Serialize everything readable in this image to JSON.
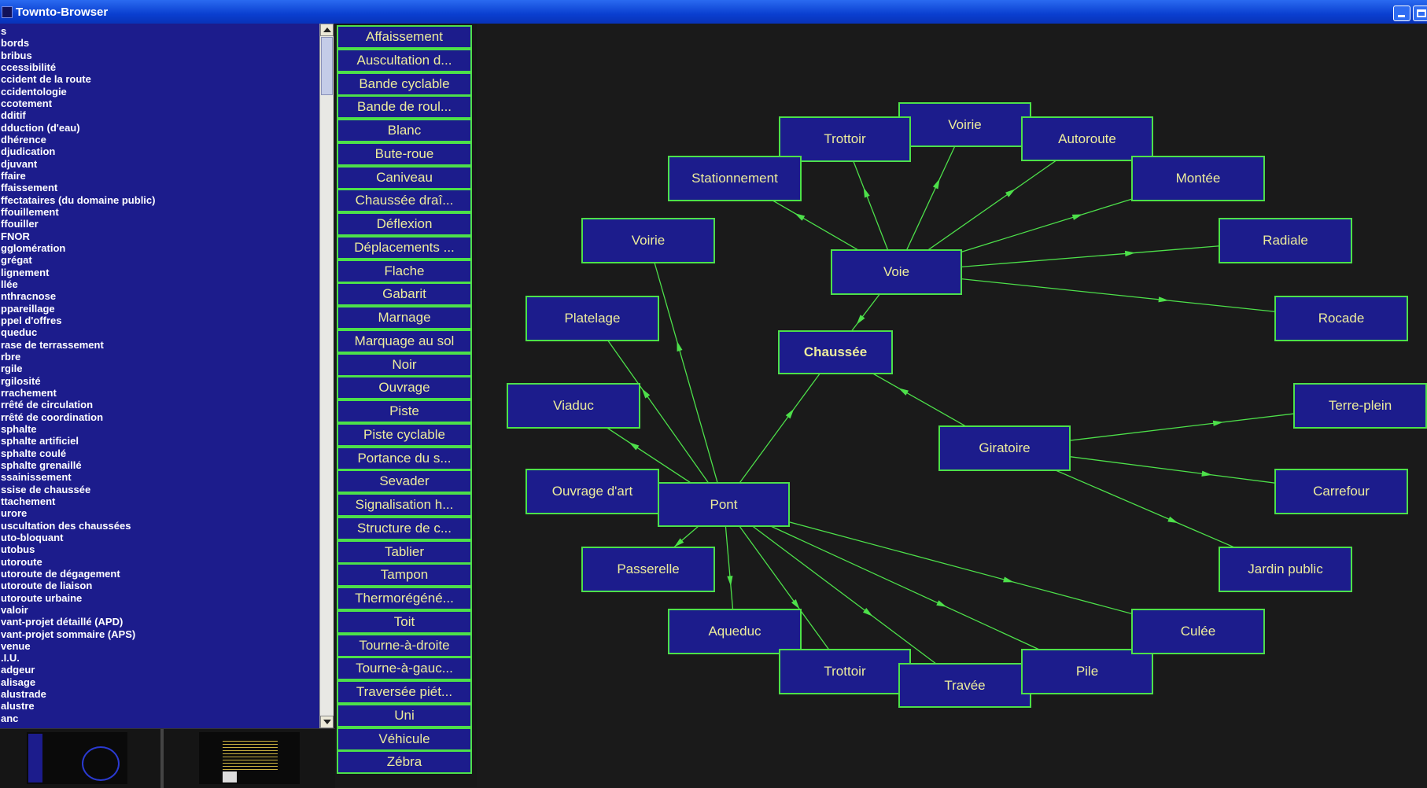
{
  "window": {
    "title": "Townto-Browser"
  },
  "word_list": [
    "s",
    "bords",
    "bribus",
    "ccessibilité",
    "ccident de la route",
    "ccidentologie",
    "ccotement",
    "dditif",
    "dduction (d'eau)",
    "dhérence",
    "djudication",
    "djuvant",
    "ffaire",
    "ffaissement",
    "ffectataires (du domaine public)",
    "ffouillement",
    "ffouiller",
    "FNOR",
    "gglomération",
    "grégat",
    "lignement",
    "llée",
    "nthracnose",
    "ppareillage",
    "ppel d'offres",
    "queduc",
    "rase de terrassement",
    "rbre",
    "rgile",
    "rgilosité",
    "rrachement",
    "rrêté de circulation",
    "rrêté de coordination",
    "sphalte",
    "sphalte artificiel",
    "sphalte coulé",
    "sphalte grenaillé",
    "ssainissement",
    "ssise de chaussée",
    "ttachement",
    "urore",
    "uscultation des chaussées",
    "uto-bloquant",
    "utobus",
    "utoroute",
    "utoroute de dégagement",
    "utoroute de liaison",
    "utoroute urbaine",
    "valoir",
    "vant-projet détaillé (APD)",
    "vant-projet sommaire (APS)",
    "venue",
    ".I.U.",
    "adgeur",
    "alisage",
    "alustrade",
    "alustre",
    "anc"
  ],
  "terms": [
    "Affaissement",
    "Auscultation d...",
    "Bande cyclable",
    "Bande de roul...",
    "Blanc",
    "Bute-roue",
    "Caniveau",
    "Chaussée draî...",
    "Déflexion",
    "Déplacements ...",
    "Flache",
    "Gabarit",
    "Marnage",
    "Marquage au sol",
    "Noir",
    "Ouvrage",
    "Piste",
    "Piste cyclable",
    "Portance du s...",
    "Sevader",
    "Signalisation h...",
    "Structure de c...",
    "Tablier",
    "Tampon",
    "Thermorégéné...",
    "Toit",
    "Tourne-à-droite",
    "Tourne-à-gauc...",
    "Traversée piét...",
    "Uni",
    "Véhicule",
    "Zébra"
  ],
  "graph": {
    "focus": "Chaussée",
    "nodes": [
      {
        "id": "chaussee",
        "label": "Chaussée",
        "focus": true
      },
      {
        "id": "voie",
        "label": "Voie"
      },
      {
        "id": "pont",
        "label": "Pont"
      },
      {
        "id": "giratoire",
        "label": "Giratoire"
      },
      {
        "id": "voirie-top",
        "label": "Voirie"
      },
      {
        "id": "trottoir-top",
        "label": "Trottoir"
      },
      {
        "id": "autoroute",
        "label": "Autoroute"
      },
      {
        "id": "stationnement",
        "label": "Stationnement"
      },
      {
        "id": "montee",
        "label": "Montée"
      },
      {
        "id": "radiale",
        "label": "Radiale"
      },
      {
        "id": "rocade",
        "label": "Rocade"
      },
      {
        "id": "voirie-left",
        "label": "Voirie"
      },
      {
        "id": "platelage",
        "label": "Platelage"
      },
      {
        "id": "viaduc",
        "label": "Viaduc"
      },
      {
        "id": "ouvrage-art",
        "label": "Ouvrage d'art"
      },
      {
        "id": "passerelle",
        "label": "Passerelle"
      },
      {
        "id": "aqueduc",
        "label": "Aqueduc"
      },
      {
        "id": "trottoir-bottom",
        "label": "Trottoir"
      },
      {
        "id": "travee",
        "label": "Travée"
      },
      {
        "id": "pile",
        "label": "Pile"
      },
      {
        "id": "culee",
        "label": "Culée"
      },
      {
        "id": "terre-plein",
        "label": "Terre-plein"
      },
      {
        "id": "carrefour",
        "label": "Carrefour"
      },
      {
        "id": "jardin-public",
        "label": "Jardin public"
      }
    ],
    "edges": [
      [
        "voie",
        "chaussee"
      ],
      [
        "pont",
        "chaussee"
      ],
      [
        "giratoire",
        "chaussee"
      ],
      [
        "voie",
        "voirie-top"
      ],
      [
        "voie",
        "trottoir-top"
      ],
      [
        "voie",
        "autoroute"
      ],
      [
        "voie",
        "stationnement"
      ],
      [
        "voie",
        "montee"
      ],
      [
        "voie",
        "radiale"
      ],
      [
        "voie",
        "rocade"
      ],
      [
        "pont",
        "voirie-left"
      ],
      [
        "pont",
        "platelage"
      ],
      [
        "pont",
        "viaduc"
      ],
      [
        "pont",
        "ouvrage-art"
      ],
      [
        "pont",
        "passerelle"
      ],
      [
        "pont",
        "aqueduc"
      ],
      [
        "pont",
        "trottoir-bottom"
      ],
      [
        "pont",
        "travee"
      ],
      [
        "pont",
        "pile"
      ],
      [
        "pont",
        "culee"
      ],
      [
        "giratoire",
        "terre-plein"
      ],
      [
        "giratoire",
        "carrefour"
      ],
      [
        "giratoire",
        "jardin-public"
      ]
    ],
    "colors": {
      "node_fill": "#1c1c8c",
      "node_border": "#4de04a",
      "node_text": "#ecec9c",
      "edge": "#4de04a",
      "background": "#1a1a1a"
    }
  }
}
